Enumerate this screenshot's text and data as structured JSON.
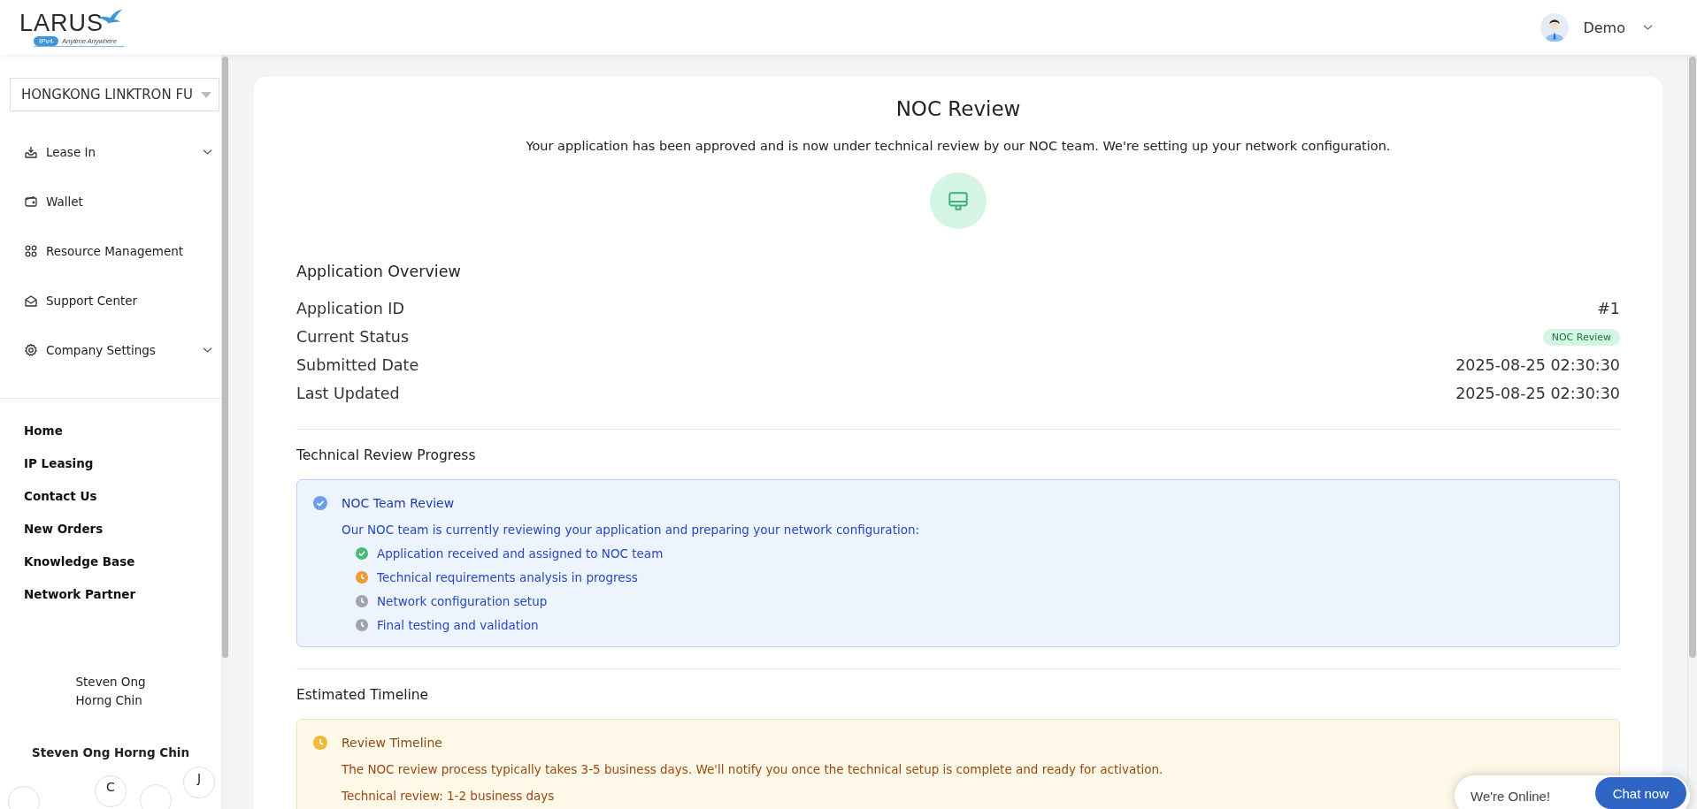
{
  "header": {
    "logo": {
      "name": "LARUS",
      "badge": "IPv4",
      "tagline": "Anytime Anywhere"
    },
    "user": {
      "name": "Demo"
    }
  },
  "sidebar": {
    "company_select": {
      "value": "HONGKONG LINKTRON FU"
    },
    "menu": [
      {
        "label": "Lease In",
        "expanded": false
      },
      {
        "label": "Wallet"
      },
      {
        "label": "Resource Management"
      },
      {
        "label": "Support Center"
      },
      {
        "label": "Company Settings",
        "expanded": false
      }
    ],
    "links": [
      "Home",
      "IP Leasing",
      "Contact Us",
      "New Orders",
      "Knowledge Base",
      "Network Partner"
    ],
    "profile": {
      "name_wrapped": "Steven Ong Horng Chin",
      "name": "Steven Ong Horng Chin",
      "avatars": [
        {
          "kind": "blank"
        },
        {
          "kind": "letter",
          "initial": "C"
        },
        {
          "kind": "blank"
        },
        {
          "kind": "letter",
          "initial": "J"
        }
      ]
    }
  },
  "main": {
    "title": "NOC Review",
    "subtitle": "Your application has been approved and is now under technical review by our NOC team. We're setting up your network configuration.",
    "overview": {
      "heading": "Application Overview",
      "rows": [
        {
          "label": "Application ID",
          "value": "#1",
          "kind": "text"
        },
        {
          "label": "Current Status",
          "value": "NOC Review",
          "kind": "badge"
        },
        {
          "label": "Submitted Date",
          "value": "2025-08-25 02:30:30",
          "kind": "text"
        },
        {
          "label": "Last Updated",
          "value": "2025-08-25 02:30:30",
          "kind": "text"
        }
      ]
    },
    "progress": {
      "heading": "Technical Review Progress",
      "title": "NOC Team Review",
      "description": "Our NOC team is currently reviewing your application and preparing your network configuration:",
      "steps": [
        {
          "label": "Application received and assigned to NOC team",
          "kind": "done"
        },
        {
          "label": "Technical requirements analysis in progress",
          "kind": "active"
        },
        {
          "label": "Network configuration setup",
          "kind": "waiting"
        },
        {
          "label": "Final testing and validation",
          "kind": "waiting"
        }
      ]
    },
    "timeline": {
      "heading": "Estimated Timeline",
      "title": "Review Timeline",
      "description": "The NOC review process typically takes 3-5 business days. We'll notify you once the technical setup is complete and ready for activation.",
      "items": [
        "Technical review: 1-2 business days"
      ]
    }
  },
  "chat_widget": {
    "status": "We're Online!",
    "button": "Chat now"
  }
}
